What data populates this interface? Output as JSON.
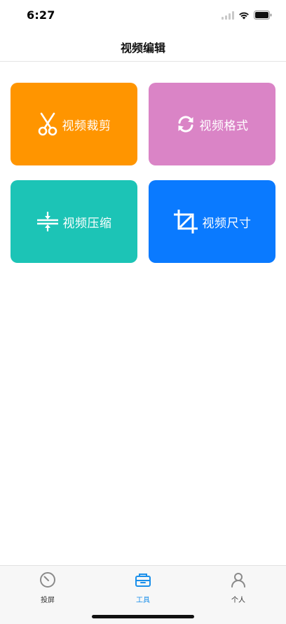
{
  "status_bar": {
    "time": "6:27"
  },
  "nav": {
    "title": "视频编辑"
  },
  "tools": [
    {
      "label": "视频裁剪",
      "icon": "scissors-icon",
      "color": "#FF9500"
    },
    {
      "label": "视频格式",
      "icon": "convert-icon",
      "color": "#DA84C6"
    },
    {
      "label": "视频压缩",
      "icon": "compress-icon",
      "color": "#1CC4B6"
    },
    {
      "label": "视频尺寸",
      "icon": "crop-icon",
      "color": "#0A7AFF"
    }
  ],
  "tab_bar": {
    "active_color": "#1A8FEA",
    "inactive_color": "#8A8A8A",
    "tabs": [
      {
        "label": "投屏",
        "icon": "cast-icon",
        "active": false
      },
      {
        "label": "工具",
        "icon": "toolbox-icon",
        "active": true
      },
      {
        "label": "个人",
        "icon": "person-icon",
        "active": false
      }
    ]
  }
}
